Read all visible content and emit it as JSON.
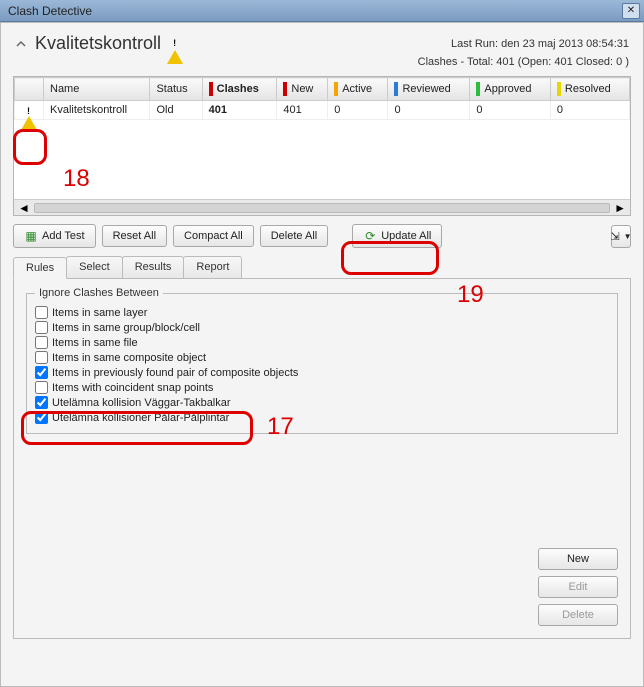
{
  "titlebar": {
    "title": "Clash Detective"
  },
  "header": {
    "test_name": "Kvalitetskontroll",
    "last_run_label": "Last Run:",
    "last_run_value": "den 23 maj 2013 08:54:31",
    "clashes_summary": "Clashes - Total: 401  (Open: 401  Closed: 0 )"
  },
  "tests_table": {
    "columns": {
      "name": "Name",
      "status": "Status",
      "clashes": "Clashes",
      "new": "New",
      "active": "Active",
      "reviewed": "Reviewed",
      "approved": "Approved",
      "resolved": "Resolved"
    },
    "rows": [
      {
        "name": "Kvalitetskontroll",
        "status": "Old",
        "clashes": "401",
        "new": "401",
        "active": "0",
        "reviewed": "0",
        "approved": "0",
        "resolved": "0"
      }
    ]
  },
  "toolbar": {
    "add_test": "Add Test",
    "reset_all": "Reset All",
    "compact_all": "Compact All",
    "delete_all": "Delete All",
    "update_all": "Update All"
  },
  "tabs": {
    "rules": "Rules",
    "select": "Select",
    "results": "Results",
    "report": "Report",
    "active": "rules"
  },
  "rules": {
    "legend": "Ignore Clashes Between",
    "items": [
      {
        "label": "Items in same layer",
        "checked": false
      },
      {
        "label": "Items in same group/block/cell",
        "checked": false
      },
      {
        "label": "Items in same file",
        "checked": false
      },
      {
        "label": "Items in same composite object",
        "checked": false
      },
      {
        "label": "Items in previously found pair of composite objects",
        "checked": true
      },
      {
        "label": "Items with coincident snap points",
        "checked": false
      },
      {
        "label": "Utelämna kollision Väggar-Takbalkar",
        "checked": true
      },
      {
        "label": "Utelämna kollisioner Pålar-Pålplintar",
        "checked": true
      }
    ],
    "buttons": {
      "new": "New",
      "edit": "Edit",
      "delete": "Delete"
    }
  },
  "annotations": {
    "a18": "18",
    "a19": "19",
    "a17": "17"
  }
}
